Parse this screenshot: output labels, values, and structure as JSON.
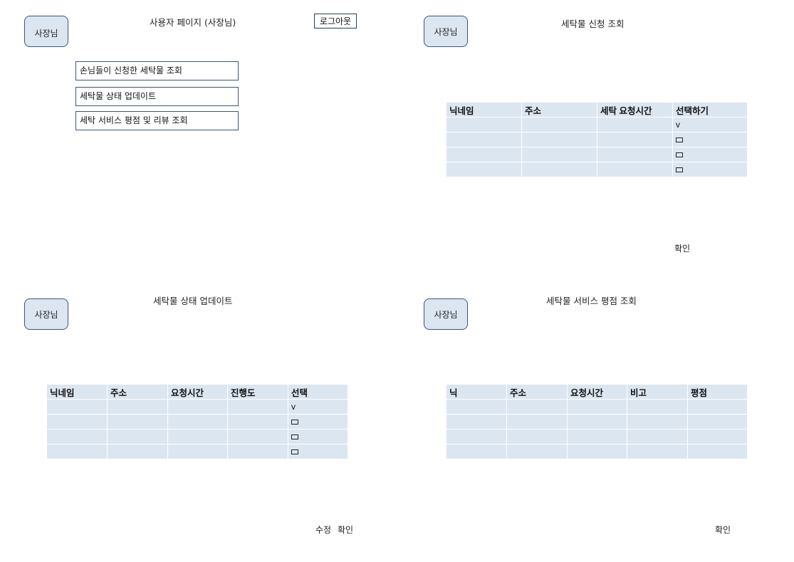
{
  "panel1": {
    "avatar": "사장님",
    "title": "사용자 페이지 (사장님)",
    "logout": "로그아웃",
    "menu": [
      "손님들이 신청한 세탁물 조회",
      "세탁물 상태 업데이트",
      "세탁 서비스 평점 및 리뷰 조회"
    ]
  },
  "panel2": {
    "avatar": "사장님",
    "title": "세탁물 신청 조회",
    "headers": [
      "닉네임",
      "주소",
      "세탁 요청시간",
      "선택하기"
    ],
    "select_marks": [
      "v",
      "box",
      "box",
      "box"
    ],
    "confirm": "확인"
  },
  "panel3": {
    "avatar": "사장님",
    "title": "세탁물 상태 업데이트",
    "headers": [
      "닉네임",
      "주소",
      "요청시간",
      "진행도",
      "선택"
    ],
    "select_marks": [
      "v",
      "box",
      "box",
      "box"
    ],
    "edit": "수정",
    "confirm": "확인"
  },
  "panel4": {
    "avatar": "사장님",
    "title": "세탁물 서비스 평점 조회",
    "headers": [
      "닉",
      "주소",
      "요청시간",
      "비고",
      "평점"
    ],
    "confirm": "확인"
  },
  "colors": {
    "cell_fill": "#dce6f1",
    "border": "#3a5579"
  }
}
